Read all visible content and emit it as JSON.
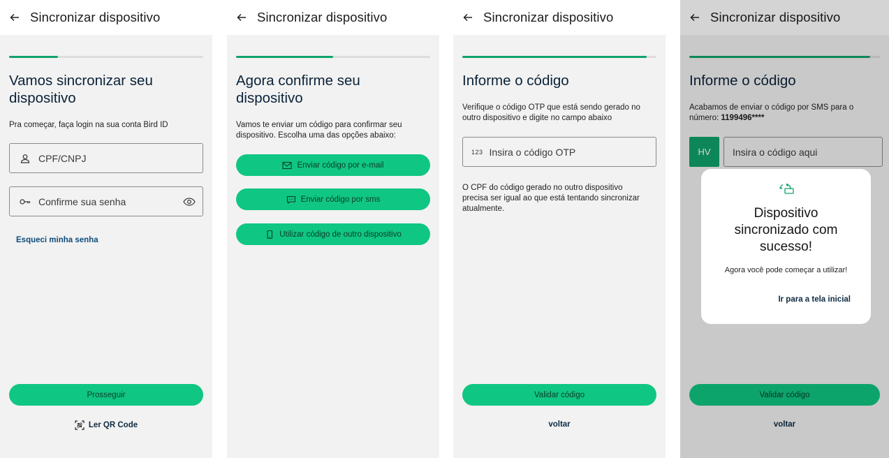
{
  "colors": {
    "accent": "#10c683",
    "progress": "#10a36b",
    "bg": "#f2f2f2"
  },
  "progress": [
    0.25,
    0.5,
    0.95,
    0.95
  ],
  "panel1": {
    "header_title": "Sincronizar dispositivo",
    "title": "Vamos sincronizar seu dispositivo",
    "description": "Pra começar, faça login na sua conta Bird ID",
    "cpf_placeholder": "CPF/CNPJ",
    "password_placeholder": "Confirme sua senha",
    "forgot_password": "Esqueci minha senha",
    "continue_button": "Prosseguir",
    "qr_link": "Ler QR Code"
  },
  "panel2": {
    "header_title": "Sincronizar dispositivo",
    "title": "Agora confirme seu dispositivo",
    "description": "Vamos te enviar um código para confirmar seu dispositivo. Escolha uma das opções abaixo:",
    "email_button": "Enviar código por e-mail",
    "sms_button": "Enviar código por sms",
    "device_button": "Utilizar código de outro dispositivo"
  },
  "panel3": {
    "header_title": "Sincronizar dispositivo",
    "title": "Informe o código",
    "description": "Verifique o código OTP que está sendo gerado no outro dispositivo e digite no campo abaixo",
    "otp_prefix": "123",
    "otp_placeholder": "Insira o código OTP",
    "note": "O CPF do código gerado no outro dispositivo precisa ser igual ao que está tentando sincronizar atualmente.",
    "validate_button": "Validar código",
    "back_link": "voltar"
  },
  "panel4": {
    "header_title": "Sincronizar dispositivo",
    "title": "Informe o código",
    "description_prefix": "Acabamos de enviar o código por SMS para o número: ",
    "phone": "1199496****",
    "prefix_box": "HV",
    "code_placeholder": "Insira o código aqui",
    "validate_button": "Validar código",
    "back_link": "voltar",
    "modal": {
      "title": "Dispositivo sincronizado com sucesso!",
      "message": "Agora você pode começar a utilizar!",
      "link": "Ir para a tela inicial"
    }
  }
}
